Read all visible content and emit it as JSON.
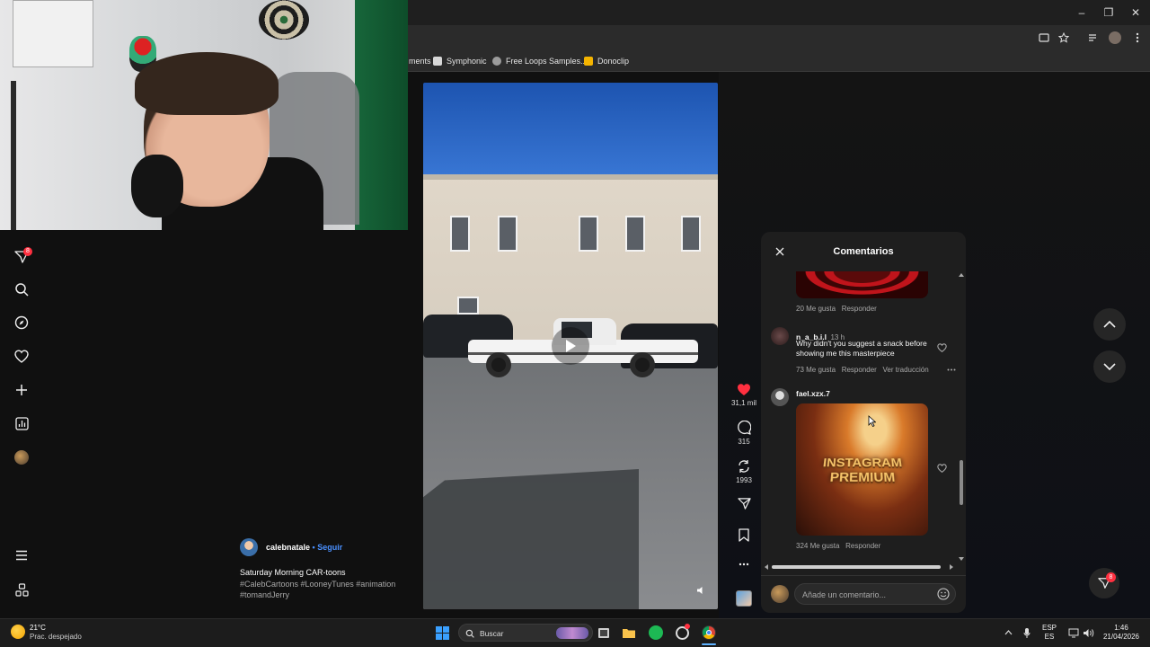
{
  "browser": {
    "bookmarks": [
      {
        "label": "ments",
        "icon": "bookmark-icon"
      },
      {
        "label": "Symphonic",
        "icon": "symphonic-icon"
      },
      {
        "label": "Free Loops Samples...",
        "icon": "freeloops-icon"
      },
      {
        "label": "Donoclip",
        "icon": "donoclip-icon"
      }
    ]
  },
  "sidebar": {
    "notifications_badge": "8",
    "icons": [
      "messages-icon",
      "search-icon",
      "explore-icon",
      "heart-icon",
      "create-icon",
      "stats-icon",
      "profile-avatar",
      "menu-icon",
      "more-icon"
    ]
  },
  "post": {
    "username": "calebnatale",
    "follow_label": "• Seguir",
    "caption_title": "Saturday Morning CAR-toons",
    "hashtags": "#CalebCartoons #LooneyTunes #animation #tomandJerry"
  },
  "actions": {
    "likes": "31,1 mil",
    "comments": "315",
    "reposts": "1993"
  },
  "comments_panel": {
    "title": "Comentarios",
    "items": [
      {
        "likes": "20 Me gusta",
        "reply": "Responder"
      },
      {
        "user": "n_a_b.i.l",
        "time": "13 h",
        "text": "Why didn't you suggest a snack before showing me this masterpiece",
        "likes": "73 Me gusta",
        "reply": "Responder",
        "translate": "Ver traducción"
      },
      {
        "user": "fael.xzx.7",
        "image_text": "INSTAGRAM PREMIUM",
        "likes": "324 Me gusta",
        "reply": "Responder"
      }
    ],
    "input_placeholder": "Añade un comentario..."
  },
  "floating_badge": "8",
  "taskbar": {
    "weather_temp": "21°C",
    "weather_desc": "Prac. despejado",
    "search_label": "Buscar",
    "lang_top": "ESP",
    "lang_bottom": "ES",
    "time": "1:46",
    "date": "21/04/2026"
  },
  "colors": {
    "like_red": "#ff3040",
    "follow_blue": "#4a90ff",
    "accent_badge": "#ff3040"
  }
}
